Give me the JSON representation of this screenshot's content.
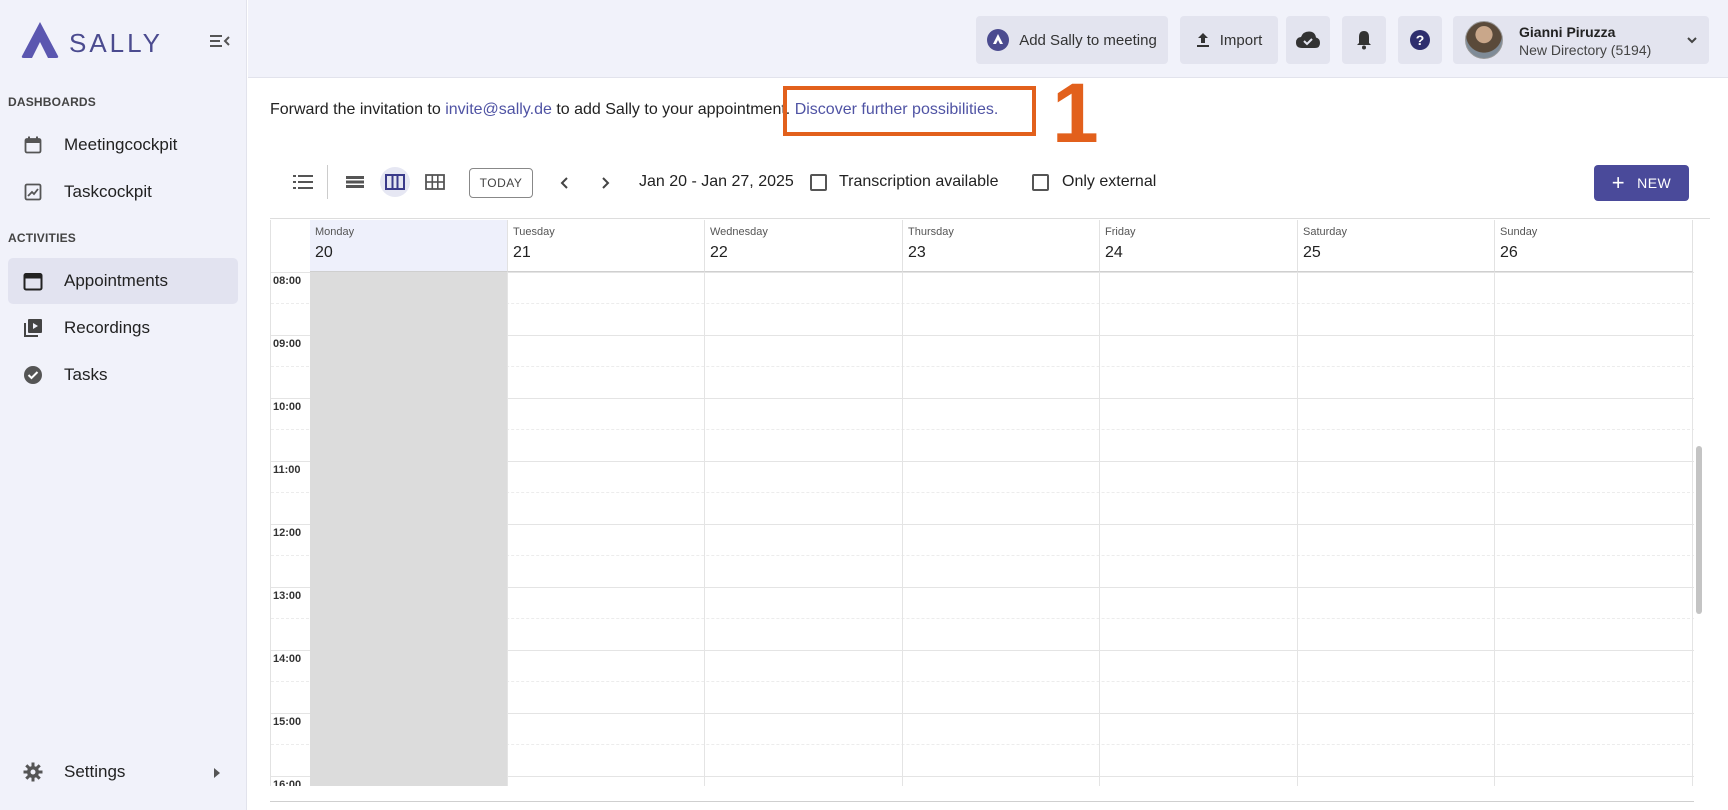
{
  "brand": {
    "name": "SALLY",
    "color": "#4b4b8f"
  },
  "sidebar": {
    "sections": [
      {
        "label": "DASHBOARDS",
        "items": [
          {
            "label": "Meetingcockpit",
            "icon": "calendar-dashboard-icon"
          },
          {
            "label": "Taskcockpit",
            "icon": "chart-icon"
          }
        ]
      },
      {
        "label": "ACTIVITIES",
        "items": [
          {
            "label": "Appointments",
            "icon": "calendar-icon",
            "active": true
          },
          {
            "label": "Recordings",
            "icon": "video-library-icon"
          },
          {
            "label": "Tasks",
            "icon": "check-circle-icon"
          }
        ]
      }
    ],
    "settings": {
      "label": "Settings",
      "icon": "gear-icon"
    }
  },
  "topbar": {
    "add_sally": "Add Sally to meeting",
    "import": "Import",
    "user": {
      "name": "Gianni Piruzza",
      "directory": "New Directory (5194)"
    }
  },
  "info": {
    "prefix": "Forward the invitation to",
    "email": "invite@sally.de",
    "middle": "to add Sally to your appointment.",
    "link": "Discover further possibilities."
  },
  "annotation": {
    "number": "1",
    "color": "#e2601c"
  },
  "toolbar": {
    "today": "TODAY",
    "date_range": "Jan 20 - Jan 27, 2025",
    "transcription": "Transcription available",
    "only_external": "Only external",
    "new": "NEW"
  },
  "calendar": {
    "days": [
      {
        "name": "Monday",
        "num": "20",
        "today": true
      },
      {
        "name": "Tuesday",
        "num": "21"
      },
      {
        "name": "Wednesday",
        "num": "22"
      },
      {
        "name": "Thursday",
        "num": "23"
      },
      {
        "name": "Friday",
        "num": "24"
      },
      {
        "name": "Saturday",
        "num": "25"
      },
      {
        "name": "Sunday",
        "num": "26"
      }
    ],
    "hours": [
      "08:00",
      "09:00",
      "10:00",
      "11:00",
      "12:00",
      "13:00",
      "14:00",
      "15:00",
      "16:00"
    ]
  }
}
